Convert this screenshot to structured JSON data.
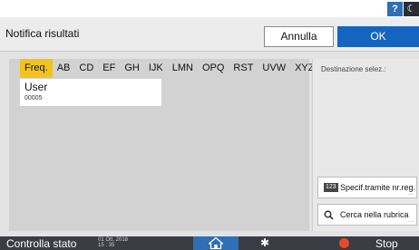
{
  "topbar": {
    "help_label": "?",
    "moon_label": "☾"
  },
  "header": {
    "title": "Notifica risultati",
    "cancel_label": "Annulla",
    "ok_label": "OK"
  },
  "tabs": [
    {
      "label": "Freq.",
      "active": true
    },
    {
      "label": "AB"
    },
    {
      "label": "CD"
    },
    {
      "label": "EF"
    },
    {
      "label": "GH"
    },
    {
      "label": "IJK"
    },
    {
      "label": "LMN"
    },
    {
      "label": "OPQ"
    },
    {
      "label": "RST"
    },
    {
      "label": "UVW"
    },
    {
      "label": "XYZ"
    }
  ],
  "swap_icon": "⇄",
  "user_card": {
    "name": "User",
    "number": "00005"
  },
  "right_panel": {
    "dest_label": "Destinazione selez.:",
    "specif_badge": "123",
    "specif_label": "Specif.tramite nr.reg.",
    "search_icon_glyph": "⚲",
    "search_label": "Cerca nella rubrica",
    "more_dots": "..."
  },
  "bottombar": {
    "status_label": "Controlla stato",
    "date_line1": "01 Ott. 2018",
    "date_line2": "15 : 35",
    "gear_glyph": "✱",
    "stop_label": "Stop"
  },
  "colors": {
    "accent": "#1565c0",
    "tab_active": "#f2c31f",
    "bar": "#3a3d43",
    "stop": "#e64a2e"
  }
}
